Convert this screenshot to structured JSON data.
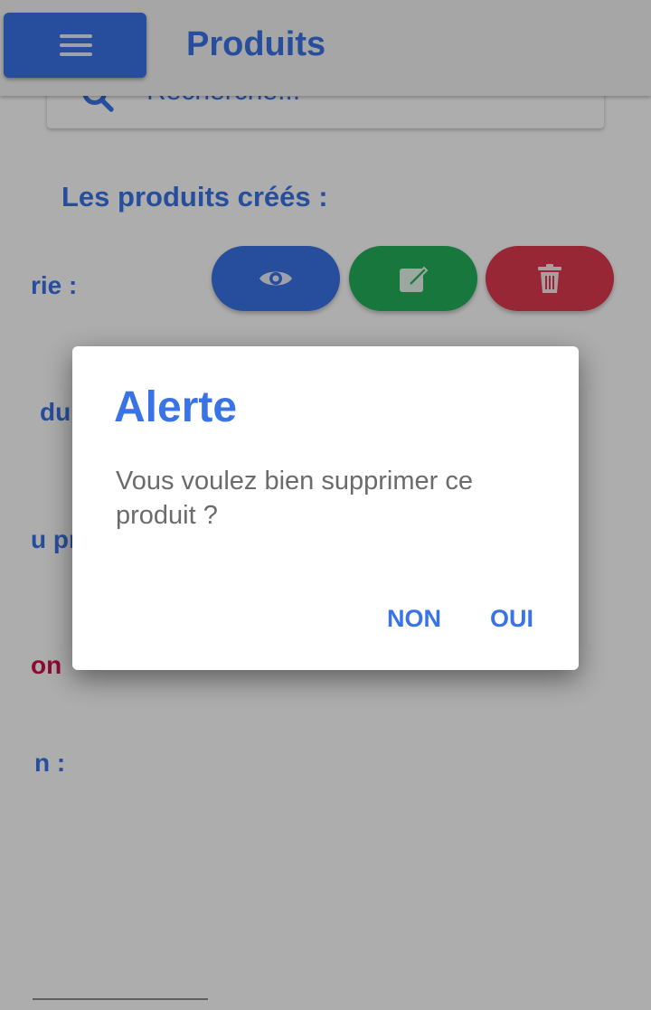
{
  "appbar": {
    "title": "Produits",
    "menu_icon": "menu-icon"
  },
  "search": {
    "placeholder": "Recherche...",
    "icon": "search-icon"
  },
  "content": {
    "section_title": "Les produits créés :",
    "labels": [
      "rie :",
      "du",
      "u pr",
      "on",
      "n :"
    ]
  },
  "actions": {
    "view_icon": "eye-icon",
    "edit_icon": "edit-icon",
    "delete_icon": "trash-icon"
  },
  "colors": {
    "primary": "#3a73e6",
    "edit": "#22b05a",
    "delete": "#e03a4e",
    "accent_red": "#d0104a"
  },
  "dialog": {
    "title": "Alerte",
    "message": "Vous voulez bien supprimer ce produit ?",
    "cancel_label": "NON",
    "confirm_label": "OUI"
  }
}
